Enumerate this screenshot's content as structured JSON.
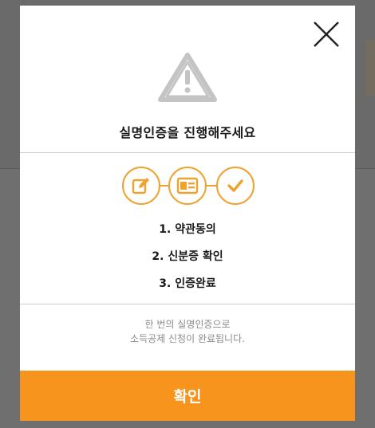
{
  "modal": {
    "title": "실명인증을 진행해주세요",
    "steps": [
      {
        "label": "1. 약관동의",
        "icon": "edit-icon"
      },
      {
        "label": "2. 신분증 확인",
        "icon": "id-card-icon"
      },
      {
        "label": "3. 인증완료",
        "icon": "check-icon"
      }
    ],
    "note_line1": "한 번의 실명인증으로",
    "note_line2": "소득공제 신청이 완료됩니다.",
    "confirm_label": "확인",
    "colors": {
      "accent": "#f7941d",
      "step_stroke": "#f0a22e",
      "warning_gray": "#c4c4c4"
    }
  }
}
